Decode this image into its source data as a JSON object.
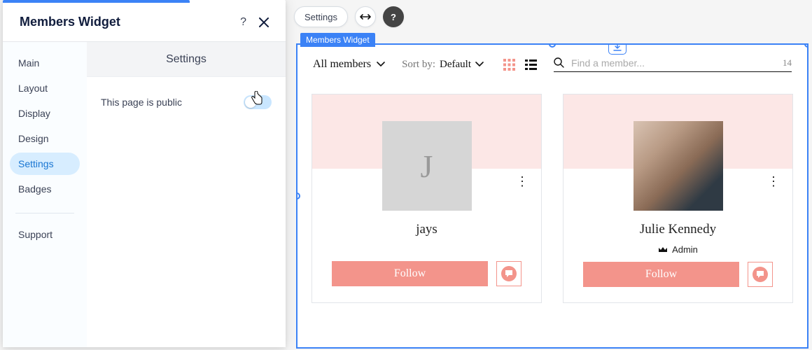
{
  "panel": {
    "title": "Members Widget",
    "help_tooltip": "?",
    "tabs": [
      "Main",
      "Layout",
      "Display",
      "Design",
      "Settings",
      "Badges"
    ],
    "active_tab_index": 4,
    "support": "Support",
    "content_header": "Settings",
    "toggle_label": "This page is public",
    "toggle_on": false
  },
  "float": {
    "settings_label": "Settings",
    "stretch_tooltip": "Stretch",
    "help_tooltip": "?"
  },
  "canvas": {
    "label": "Members Widget",
    "download_tooltip": "Download"
  },
  "toolbar": {
    "filter_label": "All members",
    "sort_prefix": "Sort by:",
    "sort_value": "Default",
    "search_placeholder": "Find a member...",
    "count": "14"
  },
  "members": [
    {
      "avatar_letter": "J",
      "has_photo": false,
      "name": "jays",
      "role": "",
      "follow_label": "Follow"
    },
    {
      "avatar_letter": "",
      "has_photo": true,
      "name": "Julie Kennedy",
      "role": "Admin",
      "follow_label": "Follow"
    }
  ]
}
